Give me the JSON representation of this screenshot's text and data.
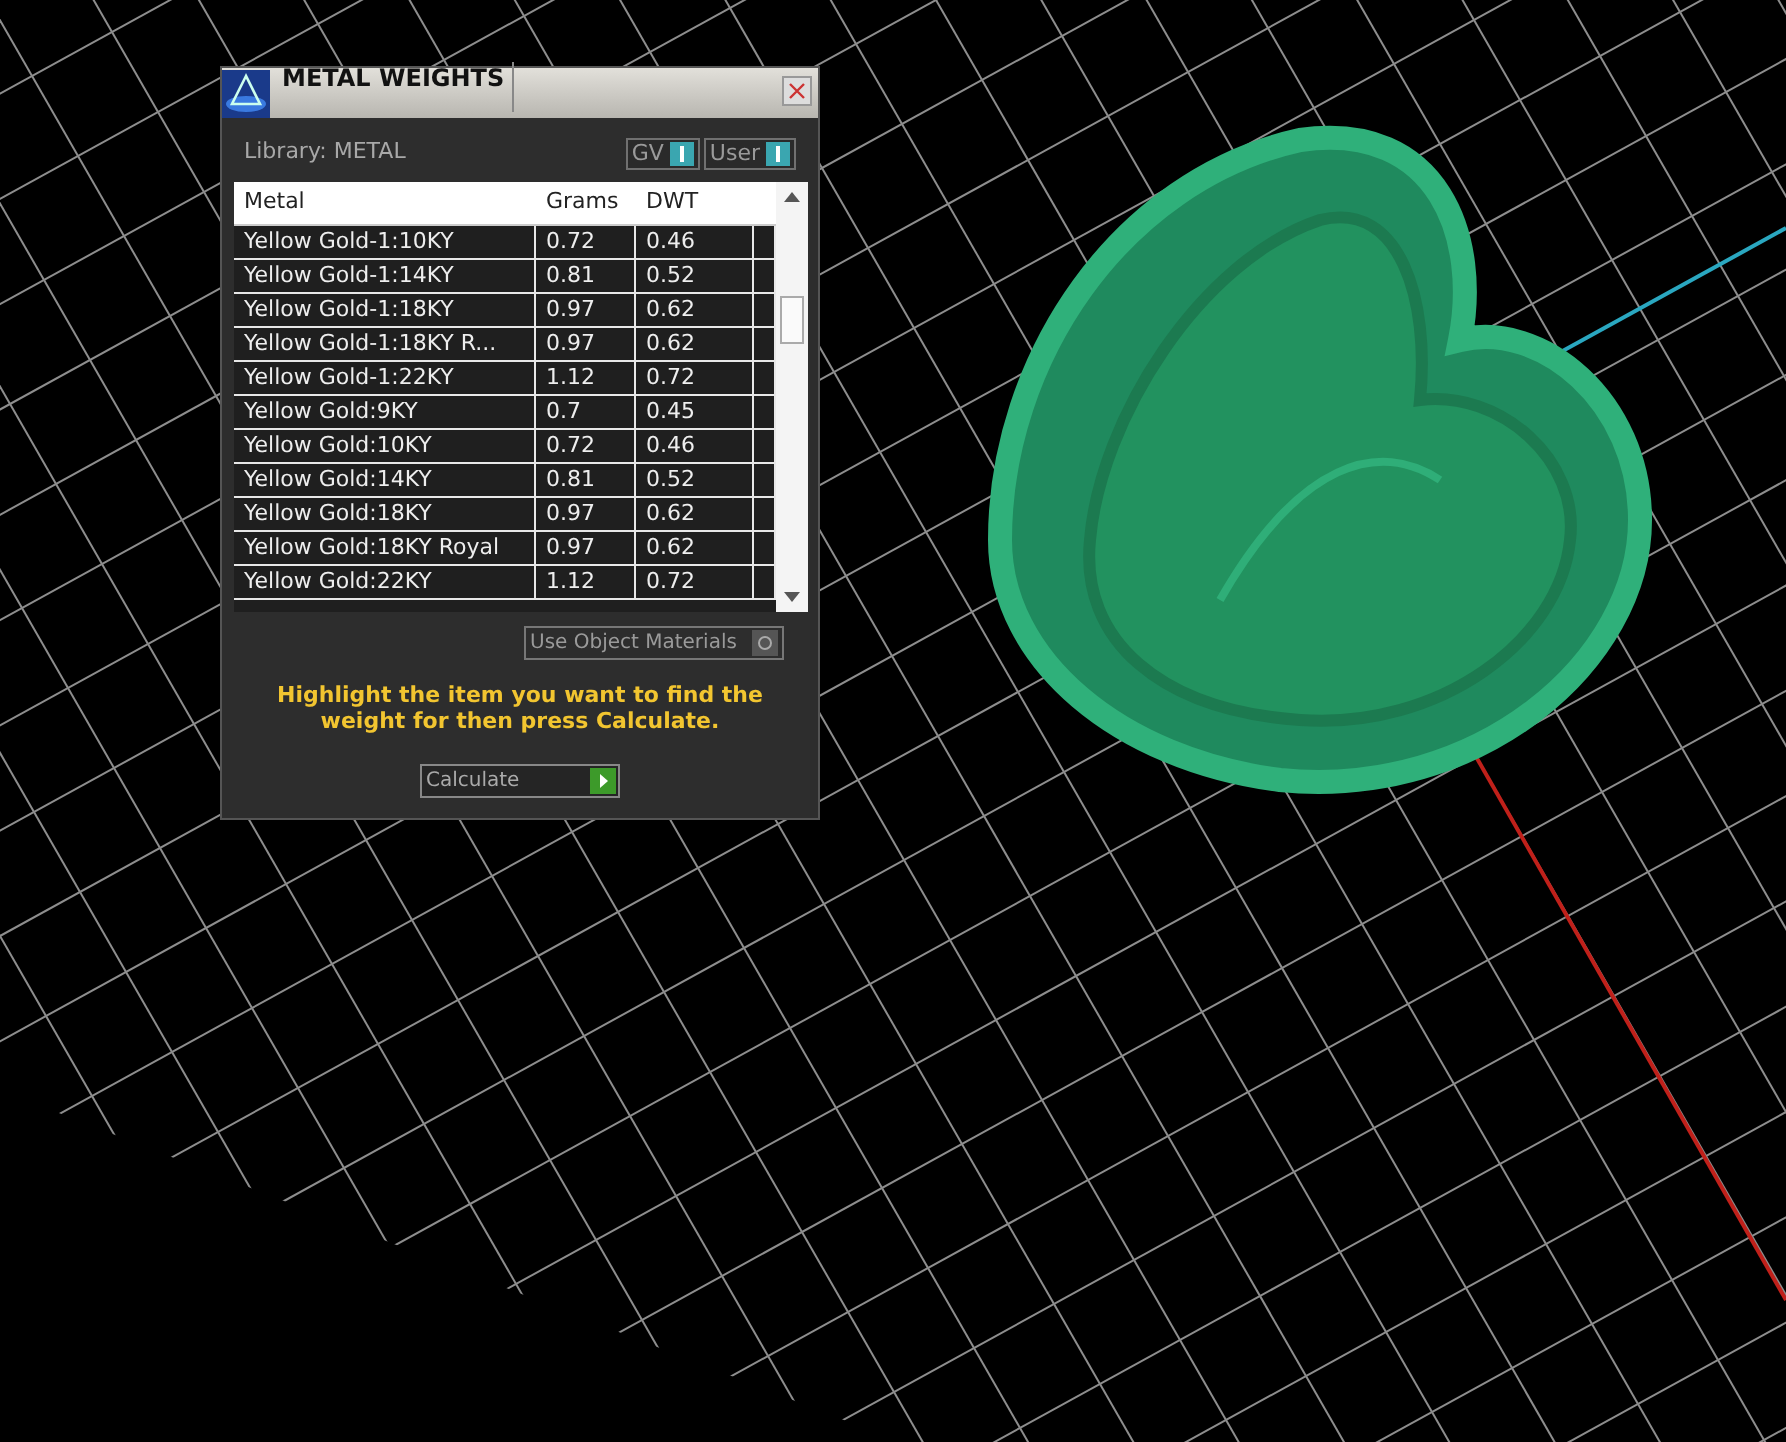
{
  "window": {
    "title": "METAL WEIGHTS"
  },
  "library": {
    "label": "Library: METAL"
  },
  "toggles": [
    {
      "label": "GV",
      "on": true
    },
    {
      "label": "User",
      "on": true
    }
  ],
  "table": {
    "columns": [
      "Metal",
      "Grams",
      "DWT"
    ],
    "rows": [
      [
        "Yellow Gold-1:10KY",
        "0.72",
        "0.46"
      ],
      [
        "Yellow Gold-1:14KY",
        "0.81",
        "0.52"
      ],
      [
        "Yellow Gold-1:18KY",
        "0.97",
        "0.62"
      ],
      [
        "Yellow Gold-1:18KY R...",
        "0.97",
        "0.62"
      ],
      [
        "Yellow Gold-1:22KY",
        "1.12",
        "0.72"
      ],
      [
        "Yellow Gold:9KY",
        "0.7",
        "0.45"
      ],
      [
        "Yellow Gold:10KY",
        "0.72",
        "0.46"
      ],
      [
        "Yellow Gold:14KY",
        "0.81",
        "0.52"
      ],
      [
        "Yellow Gold:18KY",
        "0.97",
        "0.62"
      ],
      [
        "Yellow Gold:18KY Royal",
        "0.97",
        "0.62"
      ],
      [
        "Yellow Gold:22KY",
        "1.12",
        "0.72"
      ]
    ]
  },
  "use_object_materials": {
    "label": "Use Object Materials",
    "on": false
  },
  "instruction": "Highlight the item you want to find the weight for then press Calculate.",
  "calculate_button": {
    "label": "Calculate"
  }
}
